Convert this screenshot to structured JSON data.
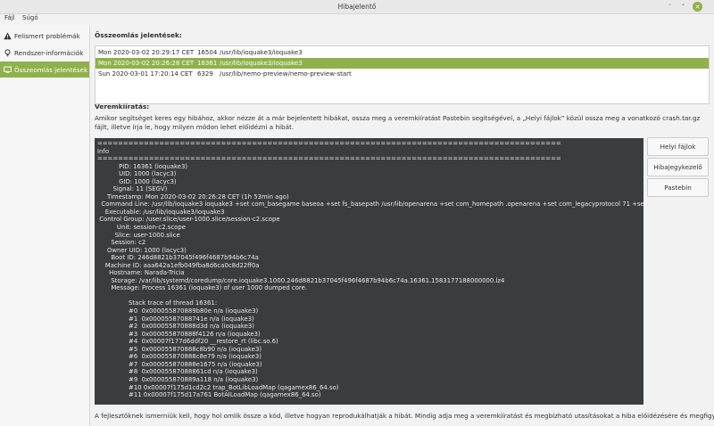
{
  "window": {
    "title": "Hibajelentő",
    "minimize_glyph": "ˇ",
    "maximize_glyph": "˄",
    "close_glyph": "✕"
  },
  "menu": {
    "file": "Fájl",
    "help": "Súgó"
  },
  "sidebar": {
    "items": [
      {
        "label": "Felismert problémák",
        "icon": "warning-icon"
      },
      {
        "label": "Rendszer-információk",
        "icon": "lightbulb-icon"
      },
      {
        "label": "Összeomlás jelentések",
        "icon": "monitor-icon"
      }
    ],
    "active_index": 2
  },
  "crash_reports": {
    "heading": "Összeomlás jelentések:",
    "rows": [
      {
        "date": "Mon 2020-03-02 20:29:17 CET",
        "pid": "16504",
        "path": "/usr/lib/ioquake3/ioquake3"
      },
      {
        "date": "Mon 2020-03-02 20:26:28 CET",
        "pid": "16361",
        "path": "/usr/lib/ioquake3/ioquake3"
      },
      {
        "date": "Sun 2020-03-01 17:20:14 CET",
        "pid": "6329",
        "path": "/usr/lib/nemo-preview/nemo-preview-start"
      }
    ],
    "selected_index": 1
  },
  "stacktrace": {
    "heading": "Veremkiíratás:",
    "description": "Amikor segítséget keres egy hibához, akkor nézze át a már bejelentett hibákat, ossza meg a veremkiíratást Pastebin segítségével, a „Helyi fájlok” közül ossza meg a vonatkozó crash.tar.gz fájlt, illetve írja le, hogy milyen módon lehet előidézni a hibát.",
    "text": "==========================================================================================\nInfo\n==========================================================================================\n           PID: 16361 (ioquake3)\n           UID: 1000 (lacyc3)\n           GID: 1000 (lacyc3)\n        Signal: 11 (SEGV)\n     Timestamp: Mon 2020-03-02 20:26:28 CET (1h 53min ago)\n  Command Line: /usr/lib/ioquake3 ioquake3 +set com_basegame baseoa +set fs_basepath /usr/lib/openarena +set com_homepath .openarena +set com_legacyprotocol 71 +set com_pr\n    Executable: /usr/lib/ioquake3/ioquake3\n Control Group: /user.slice/user-1000.slice/session-c2.scope\n          Unit: session-c2.scope\n         Slice: user-1000.slice\n       Session: c2\n     Owner UID: 1000 (lacyc3)\n       Boot ID: 246d8821b37045f496f4687b94b6c74a\n    Machine ID: aaa642a1efb049fba8d6ca0c8d22ff0a\n      Hostname: Narada-Tricia\n       Storage: /var/lib/systemd/coredump/core.ioquake3.1000.246d8821b37045f496f4687b94b6c74a.16361.1583177188000000.lz4\n       Message: Process 16361 (ioquake3) of user 1000 dumped core.\n\n                Stack trace of thread 16361:\n                #0  0x000055870889b80e n/a (ioquake3)\n                #1  0x00005587088741e n/a (ioquake3)\n                #2  0x000055870888d3d n/a (ioquake3)\n                #3  0x000055870888f4126 n/a (ioquake3)\n                #4  0x00007f177d6ddf20 __restore_rt (libc.so.6)\n                #5  0x000055870888c8b90 n/a (ioquake3)\n                #6  0x000055870888c8e79 n/a (ioquake3)\n                #7  0x000055870888e1675 n/a (ioquake3)\n                #8  0x00005587088861cd n/a (ioquake3)\n                #9  0x000055870889a118 n/a (ioquake3)\n                #10 0x00007f175d1cd2c2 trap_BotLibLoadMap (qagamex86_64.so)\n                #11 0x00007f175d17a761 BotAILoadMap (qagamex86_64.so)"
  },
  "side_buttons": {
    "local_files": "Helyi fájlok",
    "bug_tracker": "Hibajegykezelő",
    "pastebin": "Pastebin"
  },
  "footer": "A fejlesztőknek ismerniük kell, hogy hol omlik össze a kód, illetve hogyan reprodukálhatják a hibát. Mindig adja meg a veremkiíratást és megbízható utasításokat a hiba előidézésére és megfigyeléséhez.",
  "colors": {
    "accent": "#8fb14b",
    "trace_bg": "#3a3d3f"
  }
}
